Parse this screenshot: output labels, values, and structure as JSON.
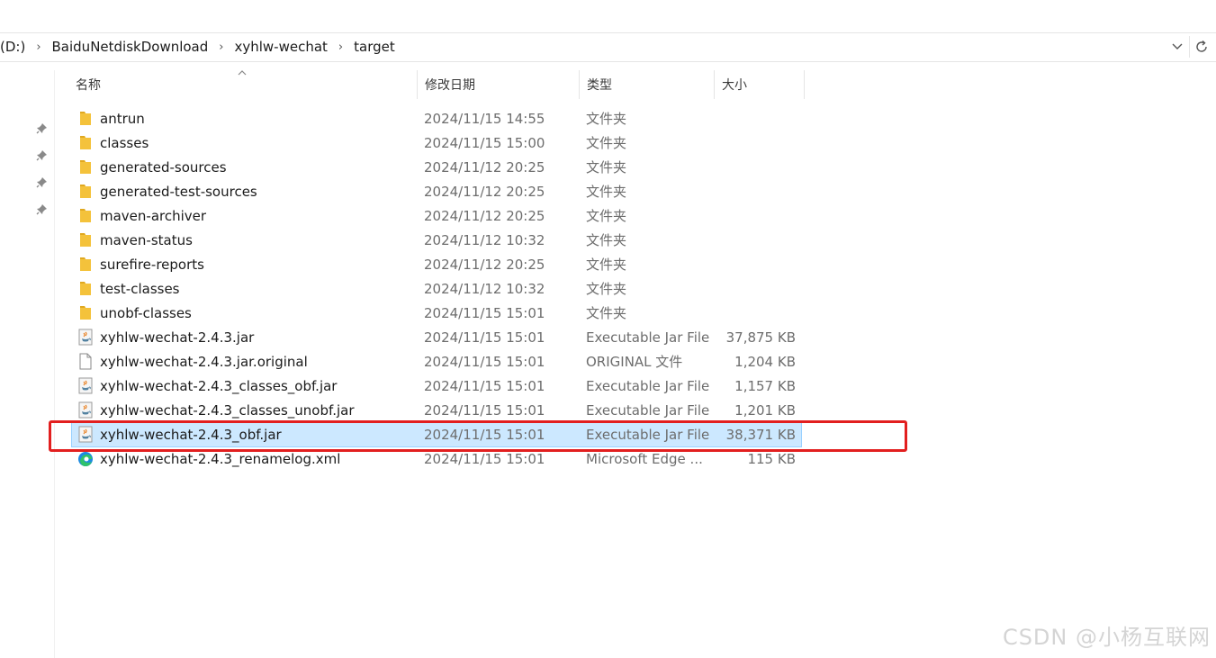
{
  "breadcrumb": [
    "(D:)",
    "BaiduNetdiskDownload",
    "xyhlw-wechat",
    "target"
  ],
  "columns": {
    "name": "名称",
    "date": "修改日期",
    "type": "类型",
    "size": "大小"
  },
  "files": [
    {
      "name": "antrun",
      "date": "2024/11/15 14:55",
      "type": "文件夹",
      "size": "",
      "icon": "folder-icon"
    },
    {
      "name": "classes",
      "date": "2024/11/15 15:00",
      "type": "文件夹",
      "size": "",
      "icon": "folder-icon"
    },
    {
      "name": "generated-sources",
      "date": "2024/11/12 20:25",
      "type": "文件夹",
      "size": "",
      "icon": "folder-icon"
    },
    {
      "name": "generated-test-sources",
      "date": "2024/11/12 20:25",
      "type": "文件夹",
      "size": "",
      "icon": "folder-icon"
    },
    {
      "name": "maven-archiver",
      "date": "2024/11/12 20:25",
      "type": "文件夹",
      "size": "",
      "icon": "folder-icon"
    },
    {
      "name": "maven-status",
      "date": "2024/11/12 10:32",
      "type": "文件夹",
      "size": "",
      "icon": "folder-icon"
    },
    {
      "name": "surefire-reports",
      "date": "2024/11/12 20:25",
      "type": "文件夹",
      "size": "",
      "icon": "folder-icon"
    },
    {
      "name": "test-classes",
      "date": "2024/11/12 10:32",
      "type": "文件夹",
      "size": "",
      "icon": "folder-icon"
    },
    {
      "name": "unobf-classes",
      "date": "2024/11/15 15:01",
      "type": "文件夹",
      "size": "",
      "icon": "folder-icon"
    },
    {
      "name": "xyhlw-wechat-2.4.3.jar",
      "date": "2024/11/15 15:01",
      "type": "Executable Jar File",
      "size": "37,875 KB",
      "icon": "jar-file-icon"
    },
    {
      "name": "xyhlw-wechat-2.4.3.jar.original",
      "date": "2024/11/15 15:01",
      "type": "ORIGINAL 文件",
      "size": "1,204 KB",
      "icon": "blank-file-icon"
    },
    {
      "name": "xyhlw-wechat-2.4.3_classes_obf.jar",
      "date": "2024/11/15 15:01",
      "type": "Executable Jar File",
      "size": "1,157 KB",
      "icon": "jar-file-icon"
    },
    {
      "name": "xyhlw-wechat-2.4.3_classes_unobf.jar",
      "date": "2024/11/15 15:01",
      "type": "Executable Jar File",
      "size": "1,201 KB",
      "icon": "jar-file-icon"
    },
    {
      "name": "xyhlw-wechat-2.4.3_obf.jar",
      "date": "2024/11/15 15:01",
      "type": "Executable Jar File",
      "size": "38,371 KB",
      "icon": "jar-file-icon",
      "selected": true
    },
    {
      "name": "xyhlw-wechat-2.4.3_renamelog.xml",
      "date": "2024/11/15 15:01",
      "type": "Microsoft Edge ...",
      "size": "115 KB",
      "icon": "edge-icon"
    }
  ],
  "watermark": "CSDN @小杨互联网",
  "colors": {
    "selection": "#cce8ff",
    "highlight": "#e21f1f",
    "folder": "#f4c23b"
  }
}
